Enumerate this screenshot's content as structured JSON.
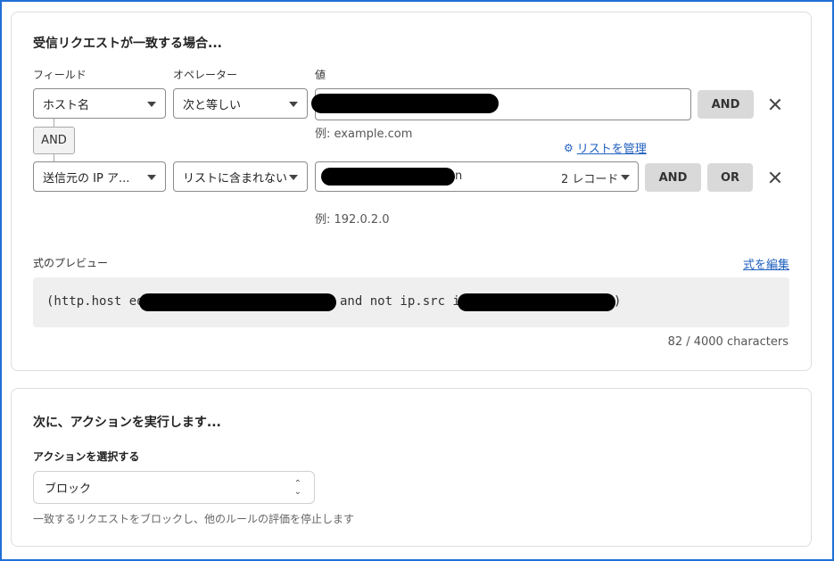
{
  "rule": {
    "title": "受信リクエストが一致する場合...",
    "col_field": "フィールド",
    "col_operator": "オペレーター",
    "col_value": "値",
    "row1": {
      "field": "ホスト名",
      "operator": "次と等しい",
      "hint": "例: example.com",
      "and_button": "AND"
    },
    "and_chip": "AND",
    "manage_list": "リストを管理",
    "row2": {
      "field": "送信元の IP ア...",
      "operator": "リストに含まれない",
      "value_suffix": "n",
      "record_count": "2 レコード",
      "hint": "例: 192.0.2.0",
      "and_button": "AND",
      "or_button": "OR"
    },
    "preview_label": "式のプレビュー",
    "edit_expression": "式を編集",
    "expr_part1": "(http.host eq",
    "expr_part2": "and not ip.src in",
    "expr_part3": ")",
    "char_count": "82 / 4000 characters"
  },
  "action": {
    "title": "次に、アクションを実行します...",
    "select_label": "アクションを選択する",
    "selected": "ブロック",
    "description": "一致するリクエストをブロックし、他のルールの評価を停止します"
  }
}
